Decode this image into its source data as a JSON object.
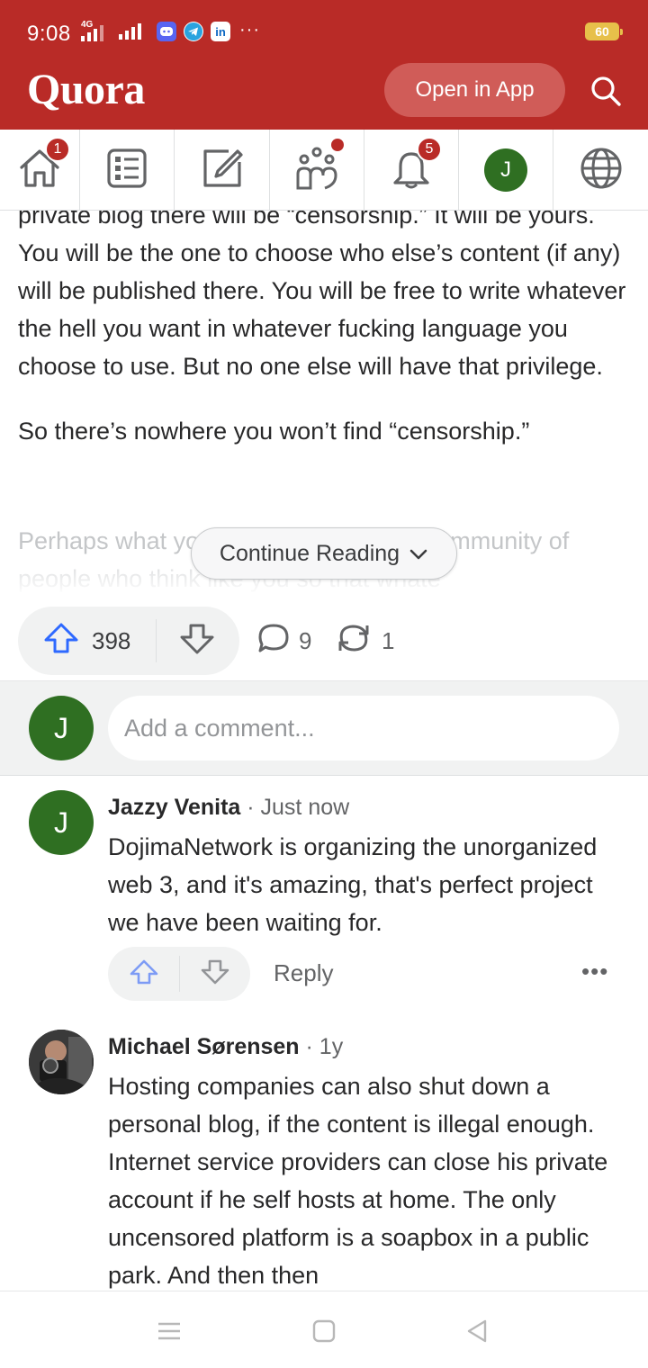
{
  "status_bar": {
    "time": "9:08",
    "network_tag": "4G",
    "apps": [
      "discord",
      "telegram",
      "linkedin"
    ],
    "linkedin_label": "in",
    "more": "···",
    "battery": "60"
  },
  "header": {
    "logo": "Quora",
    "open_app_label": "Open in App",
    "search_icon": "search-icon",
    "color": "#b92b27"
  },
  "nav": {
    "home_badge": "1",
    "notifications_badge": "5",
    "avatar_letter": "J",
    "items": [
      "home-icon",
      "following-icon",
      "write-icon",
      "spaces-icon",
      "notifications-icon",
      "profile-avatar",
      "languages-icon"
    ]
  },
  "answer": {
    "paragraphs": [
      "private blog there will be “censorship.” It will be yours. You will be the one to choose who else’s content (if any) will be published there. You will be free to write whatever the hell you want in whatever fucking language you choose to use. But no one else will have that privilege.",
      "So there’s nowhere you won’t find “censorship.”"
    ],
    "faded_text": "Perhaps what you are looking for is a community of people who think like you so that whate",
    "continue_label": "Continue Reading"
  },
  "actions": {
    "upvotes": "398",
    "comments": "9",
    "shares": "1"
  },
  "add_comment": {
    "avatar_letter": "J",
    "placeholder": "Add a comment..."
  },
  "comments": [
    {
      "author": "Jazzy Venita",
      "time": " · Just now",
      "avatar_letter": "J",
      "text": "DojimaNetwork is organizing the unorganized web 3, and it's amazing, that's perfect project we have been waiting for.",
      "reply_label": "Reply",
      "more": "•••"
    },
    {
      "author": "Michael Sørensen",
      "time": " · 1y",
      "text": "Hosting companies can also shut down a personal blog, if the content is illegal enough. Internet service providers can close his private account if he self hosts at home. The only uncensored platform is a soapbox in a public park. And then then"
    }
  ]
}
